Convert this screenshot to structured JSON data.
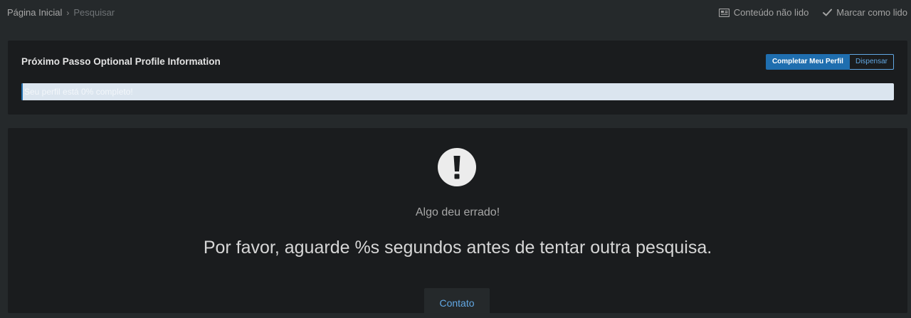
{
  "breadcrumb": {
    "home": "Página Inicial",
    "separator": "›",
    "current": "Pesquisar"
  },
  "top_actions": {
    "unread": {
      "label": "Conteúdo não lido",
      "icon": "newspaper-icon"
    },
    "mark_read": {
      "label": "Marcar como lido",
      "icon": "check-icon"
    }
  },
  "profile_step": {
    "title": "Próximo Passo Optional Profile Information",
    "complete_button": "Completar Meu Perfil",
    "dismiss_button": "Dispensar",
    "progress_text": "Seu perfil está 0% completo!",
    "progress_percent": 0
  },
  "error": {
    "icon": "exclamation-circle-icon",
    "subtitle": "Algo deu errado!",
    "message": "Por favor, aguarde %s segundos antes de tentar outra pesquisa.",
    "contact_button": "Contato"
  },
  "colors": {
    "page_background": "#25292b",
    "panel_background": "#1a1c1e",
    "accent": "#1f6eaf",
    "link": "#62a8e4",
    "progress_track": "#dbe5ef"
  }
}
